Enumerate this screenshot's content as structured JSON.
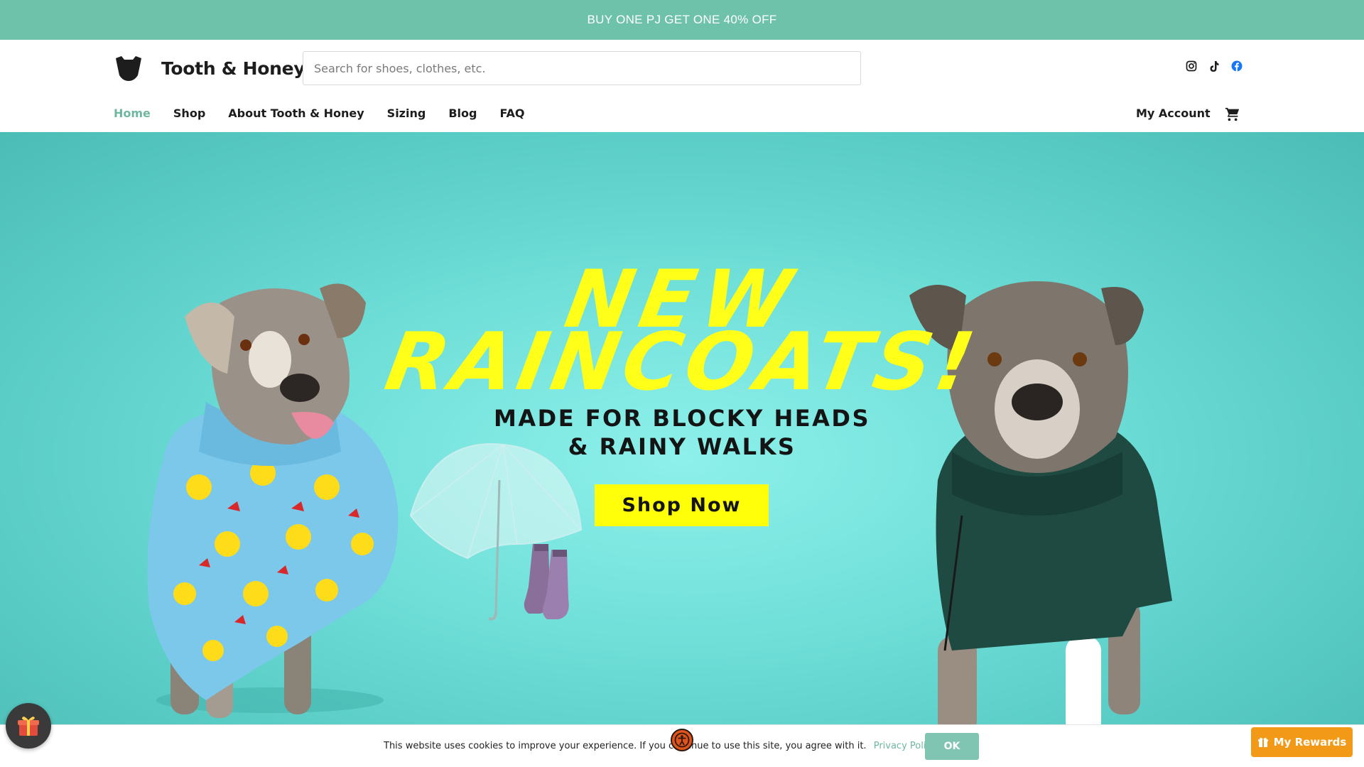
{
  "promo": {
    "text": "BUY ONE PJ GET ONE 40% OFF"
  },
  "header": {
    "brand": "Tooth & Honey",
    "search_placeholder": "Search for shoes, clothes, etc.",
    "social_icons": [
      "instagram-icon",
      "tiktok-icon",
      "facebook-icon"
    ]
  },
  "nav": {
    "items": [
      {
        "label": "Home",
        "active": true
      },
      {
        "label": "Shop"
      },
      {
        "label": "About Tooth & Honey"
      },
      {
        "label": "Sizing"
      },
      {
        "label": "Blog"
      },
      {
        "label": "FAQ"
      }
    ],
    "account_label": "My Account",
    "cart_icon": "cart-icon"
  },
  "hero": {
    "headline_line1": "NEW",
    "headline_line2": "RAINCOATS!",
    "subheadline_line1": "MADE FOR BLOCKY HEADS",
    "subheadline_line2": "& RAINY WALKS",
    "cta_label": "Shop Now"
  },
  "cookie": {
    "text": "This website uses cookies to improve your experience. If you continue to use this site, you agree with it.",
    "link_label": "Privacy Policy",
    "ok_label": "OK"
  },
  "widgets": {
    "rewards_label": "My Rewards",
    "gift_icon": "gift-icon",
    "accessibility_icon": "accessibility-icon"
  },
  "colors": {
    "promo_bg": "#6fc2aa",
    "accent": "#6fb89e",
    "hero_bg": "#6fdfd8",
    "headline": "#ffff1a",
    "cta_bg": "#ffff0a",
    "rewards_bg": "#f29a17"
  }
}
